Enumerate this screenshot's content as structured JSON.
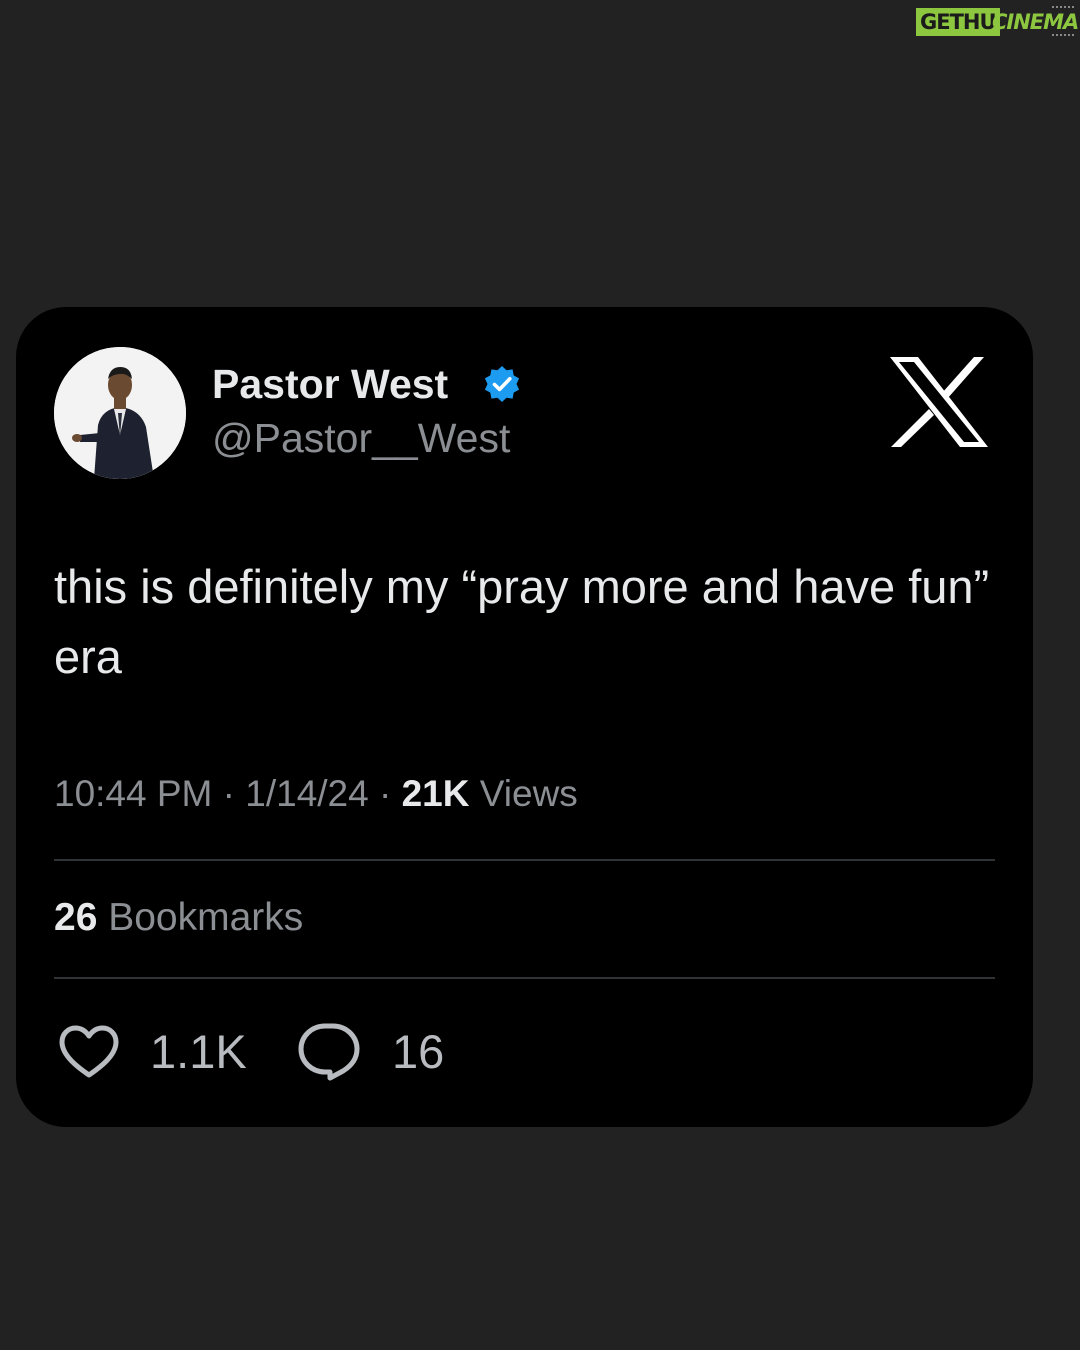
{
  "watermark": {
    "part1": "GETHU",
    "part2": "CINEMA"
  },
  "tweet": {
    "display_name": "Pastor West",
    "handle": "@Pastor__West",
    "verified": true,
    "text": "this is definitely my “pray more and have fun” era",
    "time": "10:44 PM",
    "date": "1/14/24",
    "views_count": "21K",
    "views_label": "Views",
    "bookmarks_count": "26",
    "bookmarks_label": "Bookmarks",
    "likes": "1.1K",
    "replies": "16",
    "separator": " · "
  },
  "icons": {
    "verified": "verified-badge-icon",
    "platform": "x-logo-icon",
    "like": "heart-icon",
    "reply": "speech-bubble-icon"
  },
  "colors": {
    "page_background": "#222222",
    "card_background": "#000000",
    "primary_text": "#e7e9ea",
    "secondary_text": "#8b8f93",
    "verified_blue": "#1d9bf0",
    "watermark_green": "#8dc63f"
  }
}
